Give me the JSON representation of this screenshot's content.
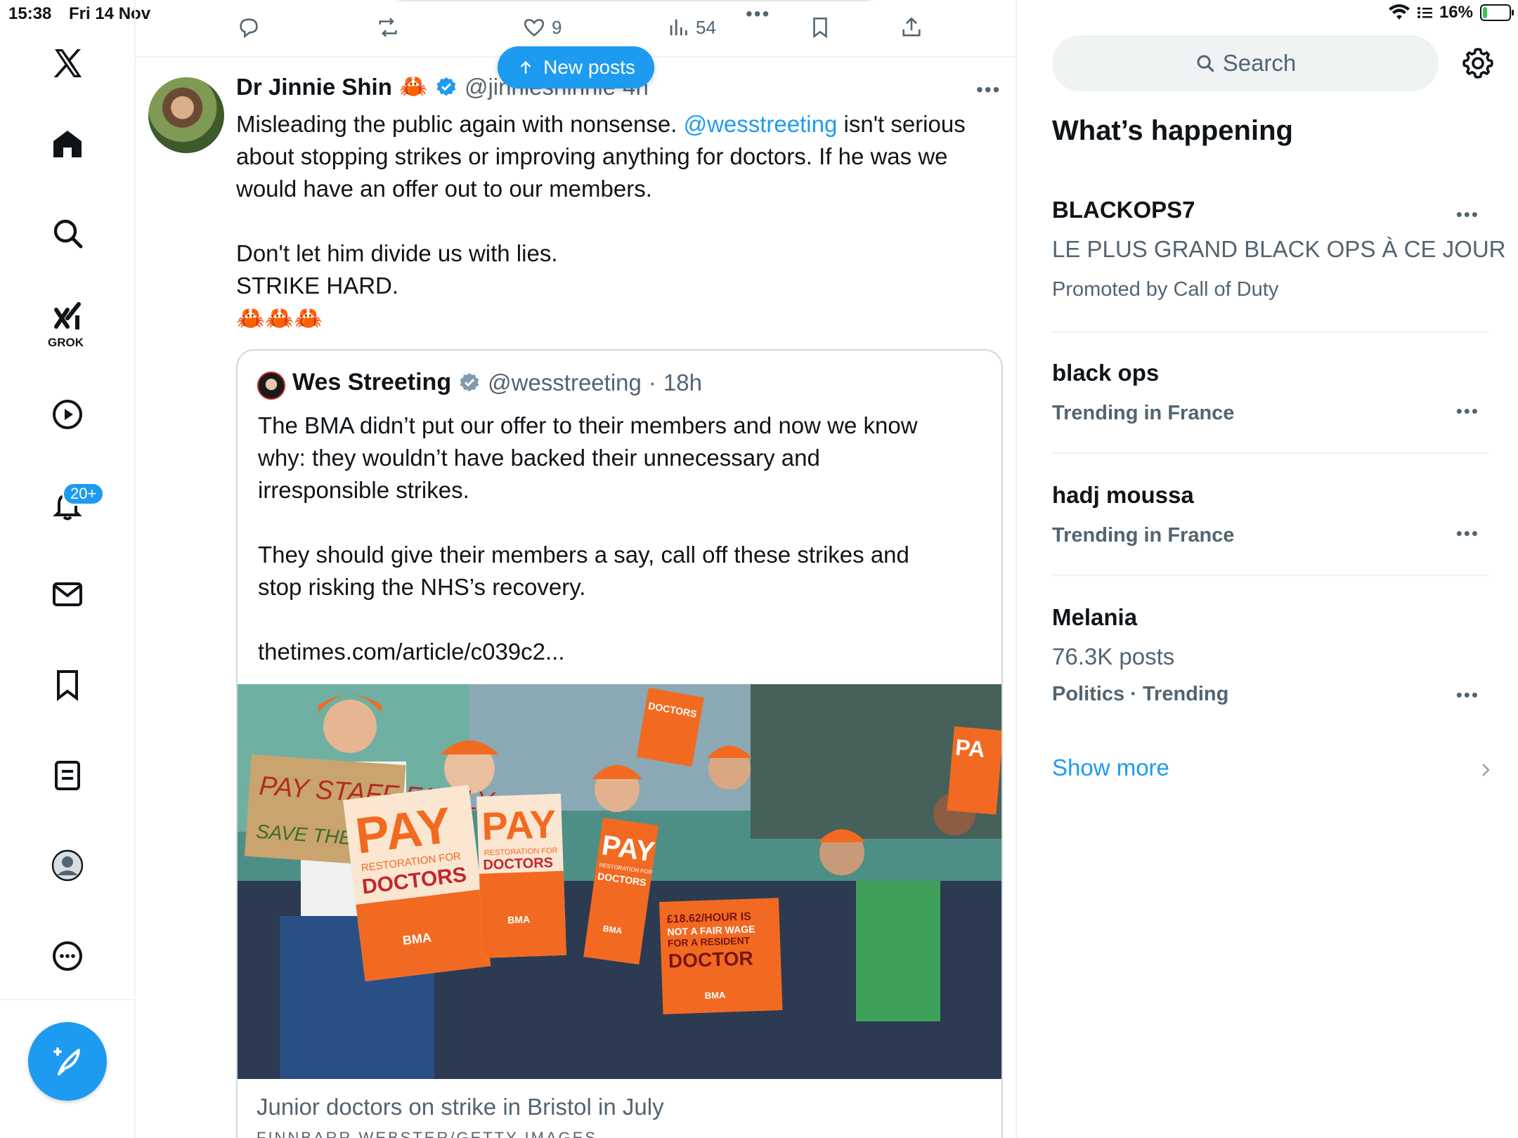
{
  "status_bar": {
    "time": "15:38",
    "date": "Fri 14 Nov",
    "battery_percent": "16%",
    "battery_level": 0.16
  },
  "nav": {
    "items": [
      "x-logo",
      "home",
      "search",
      "grok",
      "videos",
      "notifications",
      "messages",
      "bookmarks",
      "lists",
      "profile",
      "more"
    ],
    "grok_label": "GROK",
    "notification_badge": "20+"
  },
  "top_actions": {
    "likes": "9",
    "views": "54",
    "more": "•••"
  },
  "new_posts": {
    "label": "New posts"
  },
  "post": {
    "author": "Dr Jinnie Shin",
    "author_emoji": "🦀",
    "handle": "@jinnieshinnie",
    "time": "4h",
    "more": "•••",
    "line1_pre": "Misleading the public again with nonsense. ",
    "mention": "@wesstreeting",
    "line1_post": " isn't serious",
    "line2": "about stopping strikes or improving anything for doctors. If he was we",
    "line3": "would have an offer out to our members.",
    "line4": "Don't let him divide us with lies.",
    "line5": "STRIKE HARD.",
    "line6": "🦀🦀🦀"
  },
  "quote": {
    "author": "Wes Streeting",
    "handle": "@wesstreeting",
    "sep": "·",
    "time": "18h",
    "line1": "The BMA didn’t put our offer to their members and now we know",
    "line2": "why: they wouldn’t have backed their unnecessary and",
    "line3": "irresponsible strikes.",
    "line4": "They should give their members a say, call off these strikes and",
    "line5": "stop risking the NHS’s recovery.",
    "line6": "thetimes.com/article/c039c2...",
    "image": {
      "sign1": "PAY STAFF FAIRLY",
      "sign1b": "SAVE THE NHS",
      "sign2_big": "PAY",
      "sign2_small": "RESTORATION FOR",
      "sign2_doctors": "DOCTORS",
      "sign3_big": "PAY",
      "sign3_small": "RESTORATION FOR",
      "sign3_doctors": "DOCTORS",
      "sign4_big": "PAY",
      "sign4_small": "RESTORATION FOR",
      "sign4_doctors": "DOCTORS",
      "sign5_line1": "£18.62/HOUR IS",
      "sign5_line2": "NOT A FAIR WAGE",
      "sign5_line3": "FOR A RESIDENT",
      "sign5_line4": "DOCTOR",
      "top_sign": "DOCTORS",
      "right_sign": "PA",
      "bma": "BMA"
    },
    "caption": "Junior doctors on strike in Bristol in July",
    "credit": "FINNBARR WEBSTER/GETTY IMAGES"
  },
  "sidebar": {
    "search_placeholder": "Search",
    "section_title": "What’s happening",
    "trends": [
      {
        "name": "BLACKOPS7",
        "line": "LE PLUS GRAND BLACK OPS À CE JOUR",
        "meta": "Promoted by Call of Duty"
      },
      {
        "name": "black ops",
        "meta": "Trending in France"
      },
      {
        "name": "hadj moussa",
        "meta": "Trending in France"
      },
      {
        "name": "Melania",
        "line": "76.3K posts",
        "meta": "Politics · Trending"
      }
    ],
    "trend_more": "•••",
    "show_more": "Show more"
  },
  "colors": {
    "accent": "#1d9bf0",
    "text": "#0f1419",
    "secondary_text": "#536471",
    "border": "#eff3f4"
  }
}
